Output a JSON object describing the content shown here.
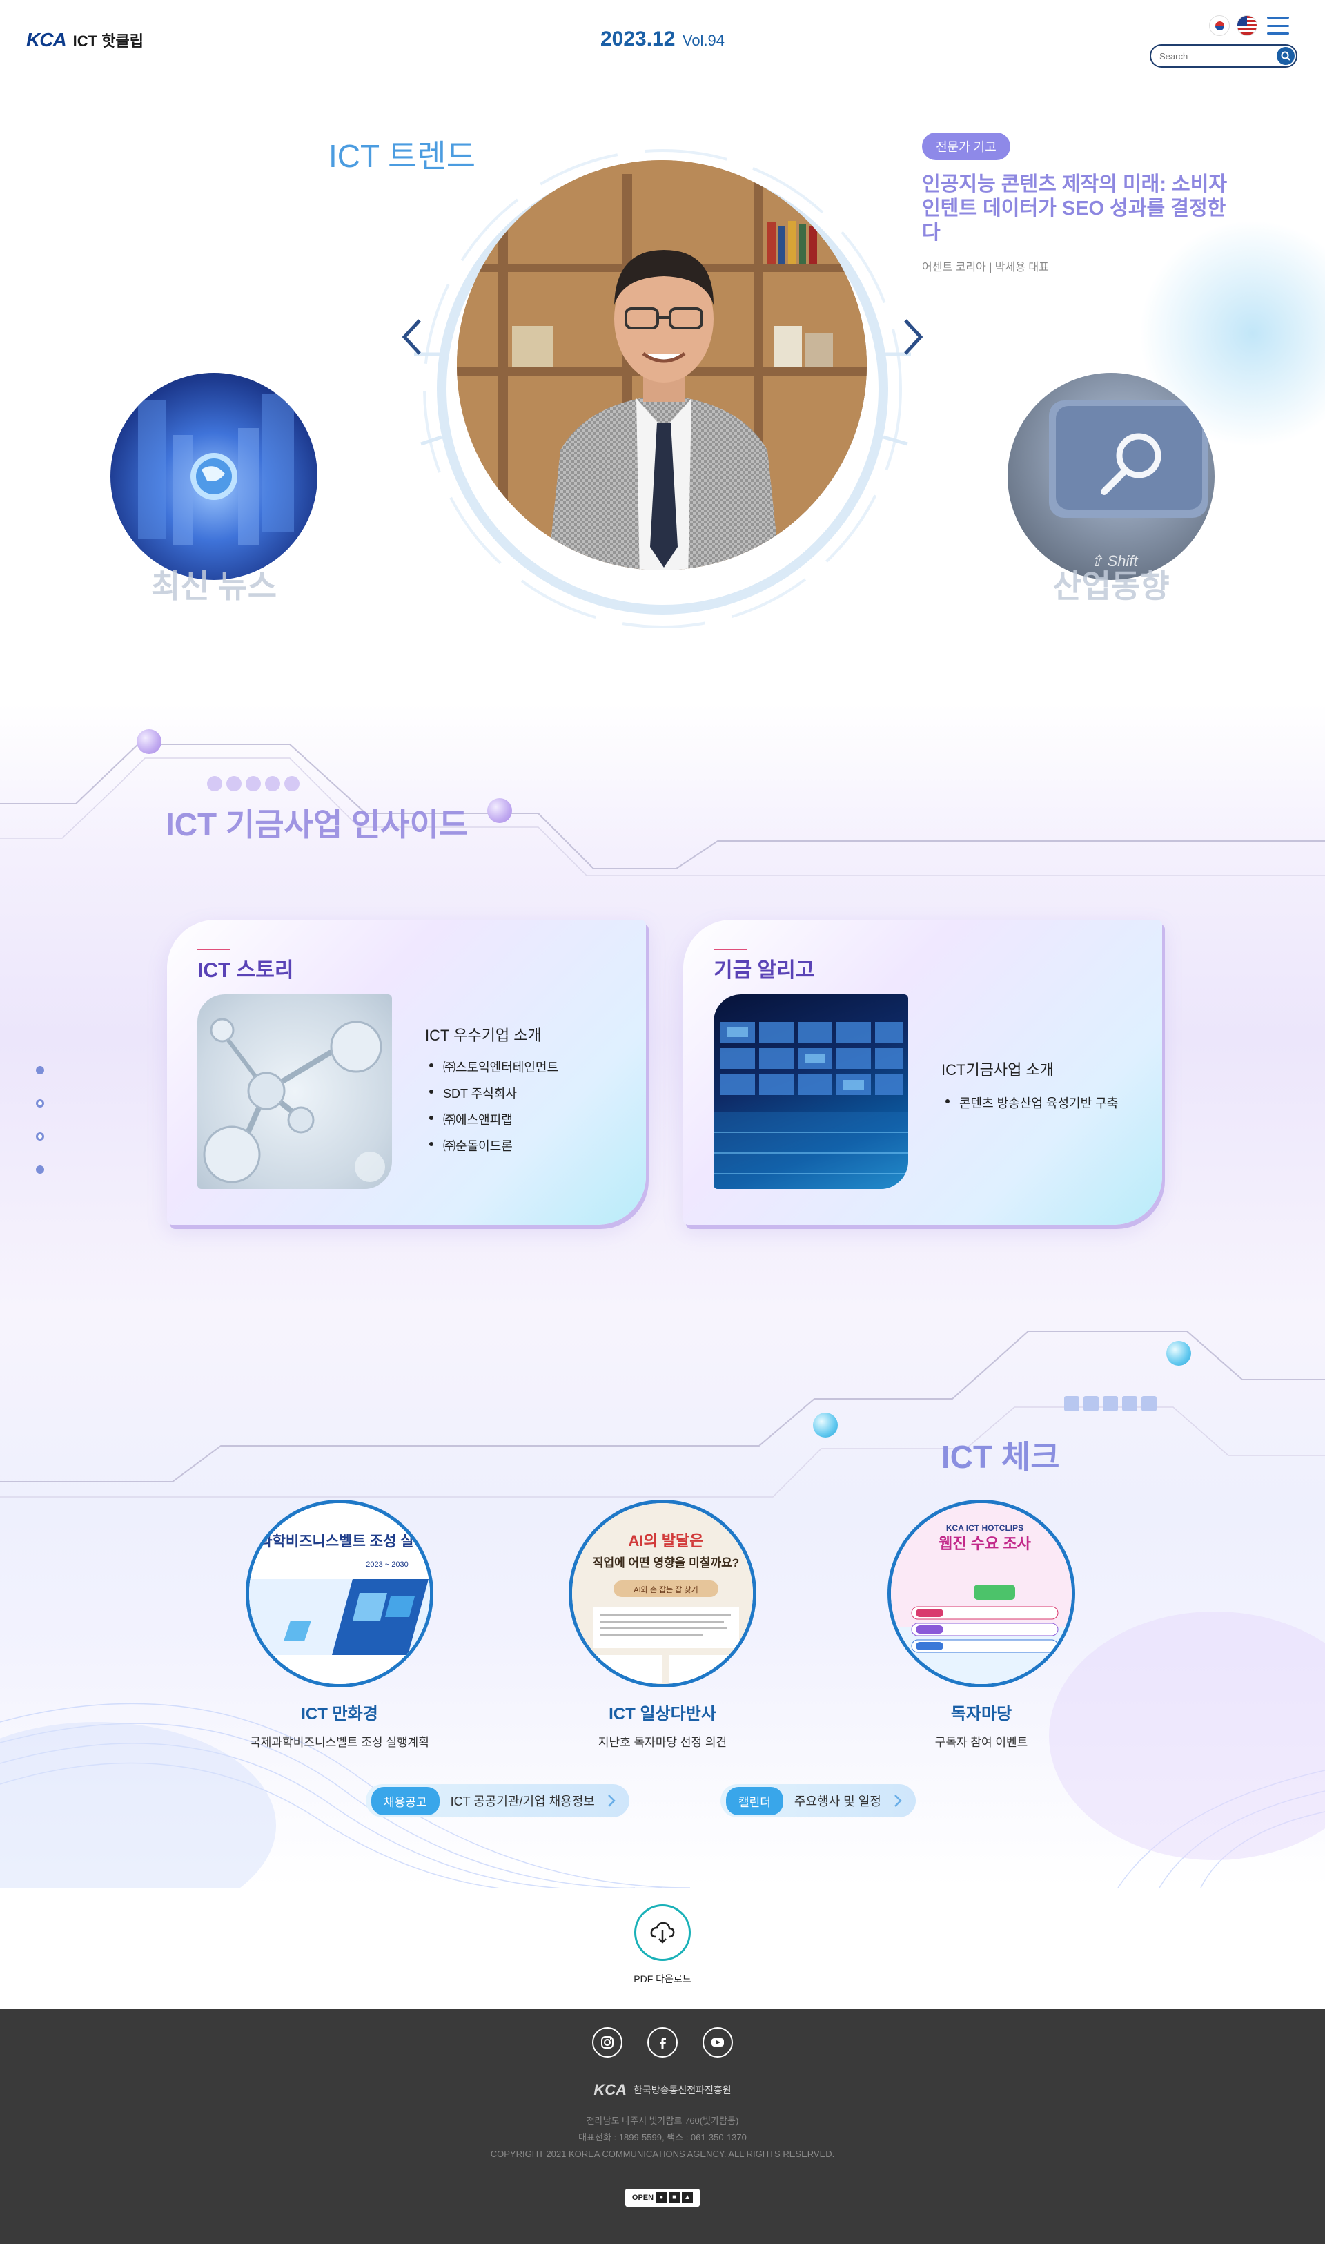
{
  "header": {
    "logo_mark": "KCA",
    "logo_text": "ICT 핫클립",
    "issue_date": "2023.12",
    "issue_vol": "Vol.94",
    "search_placeholder": "Search"
  },
  "hero": {
    "section_title": "ICT 트렌드",
    "expert_badge": "전문가 기고",
    "expert_title": "인공지능 콘텐츠 제작의 미래: 소비자 인텐트 데이터가 SEO 성과를 결정한다",
    "expert_author": "어센트 코리아 | 박세용 대표",
    "left_label": "최신 뉴스",
    "right_label": "산업동향"
  },
  "inside": {
    "section_title": "ICT 기금사업 인사이드",
    "cards": [
      {
        "title": "ICT 스토리",
        "subtitle": "ICT 우수기업 소개",
        "items": [
          "㈜스토익엔터테인먼트",
          "SDT 주식회사",
          "㈜에스앤피랩",
          "㈜순돌이드론"
        ]
      },
      {
        "title": "기금 알리고",
        "subtitle": "ICT기금사업 소개",
        "items": [
          "콘텐츠 방송산업 육성기반 구축"
        ]
      }
    ]
  },
  "check": {
    "section_title": "ICT 체크",
    "tiles": [
      {
        "title": "ICT 만화경",
        "subtitle": "국제과학비즈니스벨트 조성 실행계획",
        "thumb_heading": "국제과학비즈니스벨트 조성 실행계획",
        "thumb_years": "2023 ~ 2030"
      },
      {
        "title": "ICT 일상다반사",
        "subtitle": "지난호 독자마당 선정 의견",
        "thumb_heading_a": "AI의 발달은",
        "thumb_heading_b": "직업에 어떤 영향을 미칠까요?",
        "thumb_tag": "AI와 손 잡는 잡 찾기"
      },
      {
        "title": "독자마당",
        "subtitle": "구독자 참여 이벤트",
        "thumb_brand": "KCA ICT HOTCLIPS",
        "thumb_heading": "웹진 수요 조사"
      }
    ],
    "pills": [
      {
        "badge": "채용공고",
        "label": "ICT 공공기관/기업 채용정보"
      },
      {
        "badge": "캘린더",
        "label": "주요행사 및 일정"
      }
    ]
  },
  "pdf": {
    "label": "PDF 다운로드"
  },
  "footer": {
    "logo_mark": "KCA",
    "org_name": "한국방송통신전파진흥원",
    "address": "전라남도 나주시 빛가람로 760(빛가람동)",
    "contact": "대표전화 : 1899-5599, 팩스 : 061-350-1370",
    "copyright": "COPYRIGHT 2021 KOREA COMMUNICATIONS AGENCY. ALL RIGHTS RESERVED.",
    "open_label": "OPEN"
  },
  "colors": {
    "brand_blue": "#1a5fa6",
    "hero_title": "#4b9ce0",
    "lavender": "#8e89e8",
    "inside_title": "#9f95e2",
    "check_title": "#8a8fe0",
    "footer_bg": "#3a3a3a"
  }
}
